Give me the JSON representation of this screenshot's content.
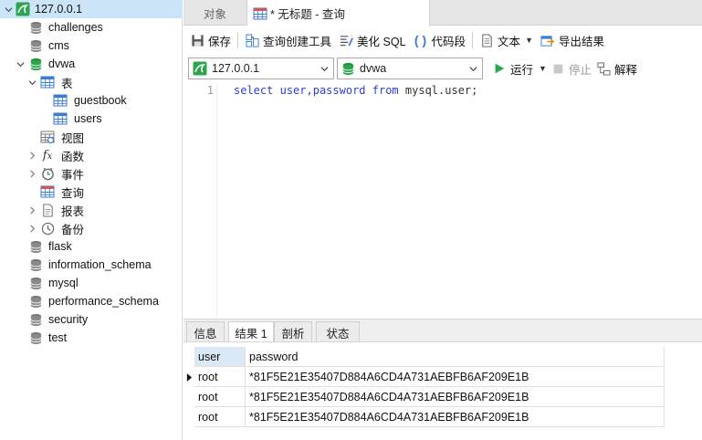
{
  "tree": {
    "connection": "127.0.0.1",
    "databases_top": [
      "challenges",
      "cms"
    ],
    "current_db": "dvwa",
    "tables_node": "表",
    "tables": [
      "guestbook",
      "users"
    ],
    "views_node": "视图",
    "functions_node": "函数",
    "events_node": "事件",
    "queries_node": "查询",
    "reports_node": "报表",
    "backups_node": "备份",
    "databases_bottom": [
      "flask",
      "information_schema",
      "mysql",
      "performance_schema",
      "security",
      "test"
    ]
  },
  "tabs": {
    "objects": "对象",
    "query": "* 无标题 - 查询"
  },
  "toolbar": {
    "save": "保存",
    "query_builder": "查询创建工具",
    "beautify_sql": "美化 SQL",
    "code_snippet": "代码段",
    "text": "文本",
    "export_results": "导出结果"
  },
  "toolbar2": {
    "connection_value": "127.0.0.1",
    "database_value": "dvwa",
    "run": "运行",
    "stop": "停止",
    "explain": "解释"
  },
  "editor": {
    "line_number": "1",
    "tokens": {
      "select": "select",
      "cols": "user,password",
      "from": "from",
      "table": "mysql.user;"
    }
  },
  "result_tabs": [
    "信息",
    "结果 1",
    "剖析",
    "状态"
  ],
  "result": {
    "columns": [
      "user",
      "password"
    ],
    "rows": [
      [
        "root",
        "*81F5E21E35407D884A6CD4A731AEBFB6AF209E1B"
      ],
      [
        "root",
        "*81F5E21E35407D884A6CD4A731AEBFB6AF209E1B"
      ],
      [
        "root",
        "*81F5E21E35407D884A6CD4A731AEBFB6AF209E1B"
      ]
    ]
  },
  "colors": {
    "db_green": "#1f8f3a",
    "selection": "#cce4f7",
    "keyword": "#2b3fd6",
    "run_green": "#2da44e"
  }
}
